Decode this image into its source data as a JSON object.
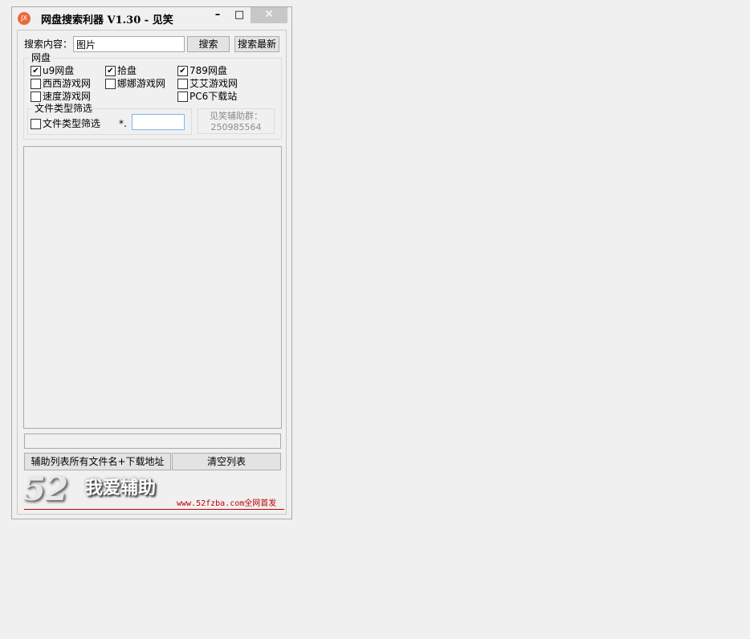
{
  "window": {
    "title": "网盘搜索利器 V1.30 - 见笑",
    "icon_text": "JX",
    "min_glyph": "–",
    "max_glyph": "□",
    "close_glyph": "✕"
  },
  "search": {
    "label": "搜索内容：",
    "value": "图片",
    "search_button": "搜索",
    "search_latest_button": "搜索最新"
  },
  "netdisk_group": {
    "legend": "网盘",
    "items": [
      {
        "label": "u9网盘",
        "checked": true
      },
      {
        "label": "拾盘",
        "checked": true
      },
      {
        "label": "789网盘",
        "checked": true
      },
      {
        "label": "西西游戏网",
        "checked": false
      },
      {
        "label": "娜娜游戏网",
        "checked": false
      },
      {
        "label": "艾艾游戏网",
        "checked": false
      },
      {
        "label": "速度游戏网",
        "checked": false
      },
      {
        "label": "PC6下载站",
        "checked": false
      }
    ]
  },
  "filetype_group": {
    "legend": "文件类型筛选",
    "checkbox_label": "文件类型筛选",
    "checked": false,
    "ext_prefix": "*.",
    "ext_value": ""
  },
  "help_group": {
    "title": "见笑辅助群：",
    "number": "250985564"
  },
  "bottom": {
    "copy_button": "辅助列表所有文件名+下载地址",
    "clear_button": "清空列表"
  },
  "banner": {
    "logo_number": "52",
    "logo_text": "我爱辅助",
    "url_text": "www.52fzba.com全网首发"
  },
  "colors": {
    "accent_icon": "#e96a3c",
    "close_button_bg": "#c7c7c7",
    "banner_red": "#c00000",
    "input_focus_border": "#7eb4ea"
  }
}
